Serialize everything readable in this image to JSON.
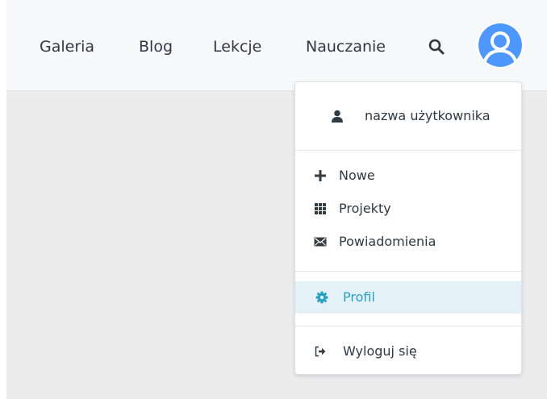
{
  "nav": {
    "links": [
      {
        "label": "Galeria"
      },
      {
        "label": "Blog"
      },
      {
        "label": "Lekcje"
      },
      {
        "label": "Nauczanie"
      }
    ]
  },
  "icons": {
    "search": "search-icon",
    "avatar": "user-avatar-icon"
  },
  "dropdown": {
    "username": "nazwa użytkownika",
    "items": [
      {
        "label": "Nowe",
        "icon": "plus-icon"
      },
      {
        "label": "Projekty",
        "icon": "grid-icon"
      },
      {
        "label": "Powiadomienia",
        "icon": "envelope-icon"
      }
    ],
    "profile": {
      "label": "Profil",
      "icon": "gear-icon",
      "active": true
    },
    "logout": {
      "label": "Wyloguj się",
      "icon": "logout-icon"
    }
  },
  "colors": {
    "brand_blue": "#4d97ff",
    "active_text": "#2a9fc4",
    "active_bg": "#e4f1f9",
    "text": "#2f3942"
  }
}
